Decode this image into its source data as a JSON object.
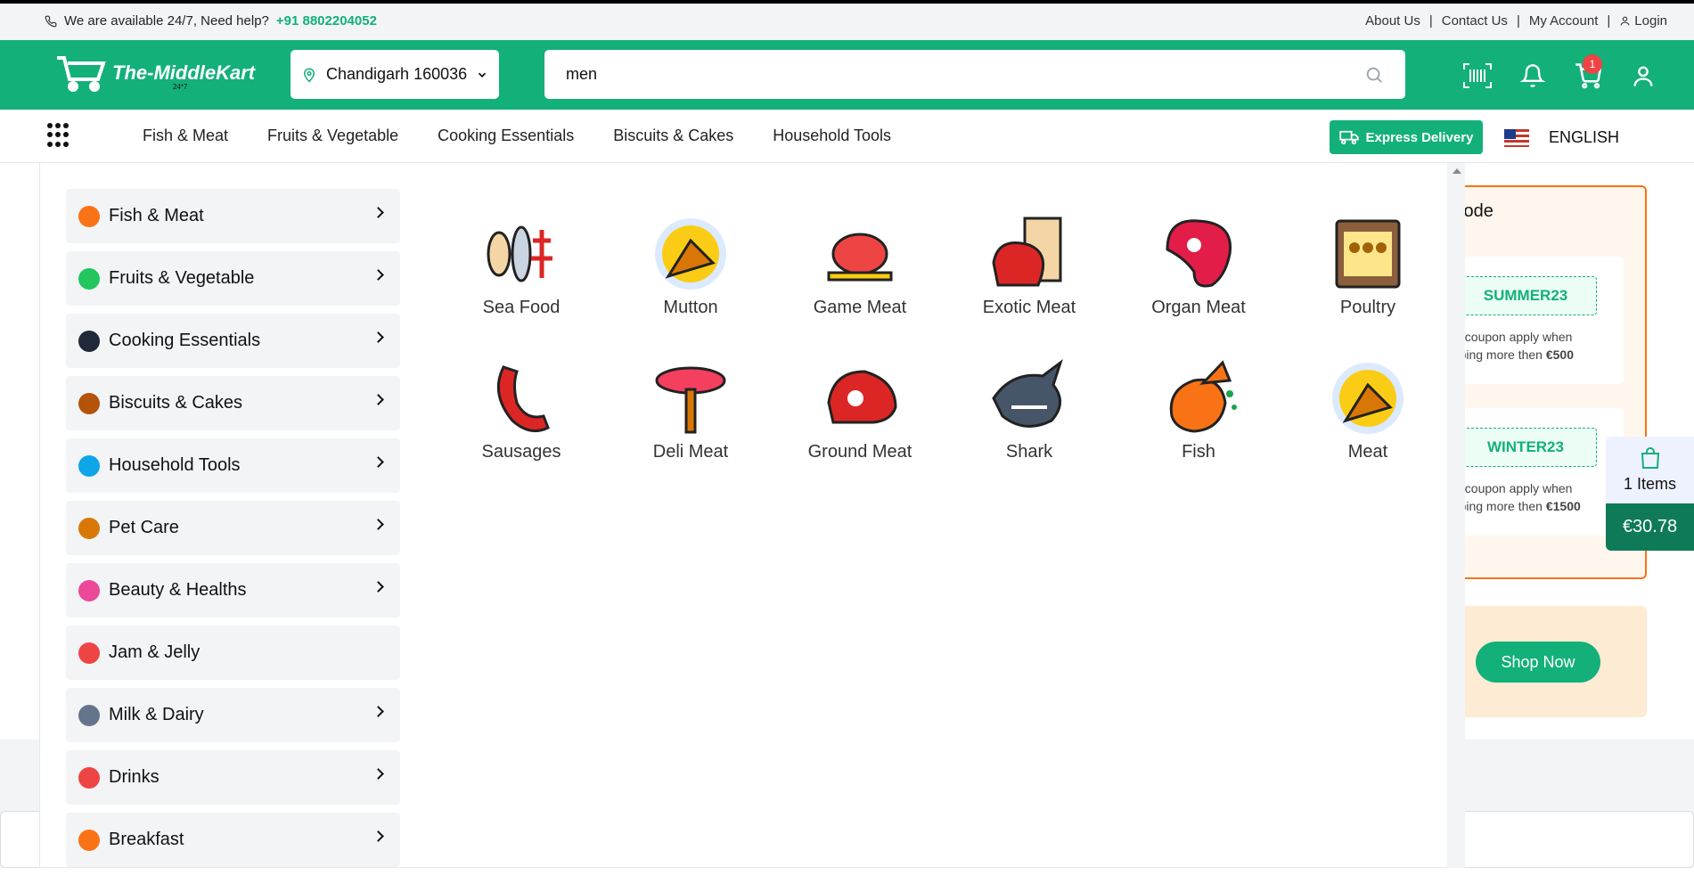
{
  "topbar": {
    "help_text": "We are available 24/7, Need help?",
    "phone": "+91 8802204052",
    "links": [
      "About Us",
      "Contact Us",
      "My Account",
      "Login"
    ]
  },
  "header": {
    "logo_text": "The-MiddleKart",
    "logo_sub": "24*7",
    "location": "Chandigarh 160036",
    "search_value": "men",
    "cart_count": "1"
  },
  "nav": {
    "links": [
      "Fish & Meat",
      "Fruits & Vegetable",
      "Cooking Essentials",
      "Biscuits & Cakes",
      "Household Tools"
    ],
    "express_label": "Express Delivery",
    "language": "ENGLISH"
  },
  "sidebar": {
    "categories": [
      {
        "label": "Fish & Meat",
        "color": "#f97316",
        "chevron": true
      },
      {
        "label": "Fruits & Vegetable",
        "color": "#22c55e",
        "chevron": true
      },
      {
        "label": "Cooking Essentials",
        "color": "#1f2937",
        "chevron": true
      },
      {
        "label": "Biscuits & Cakes",
        "color": "#b45309",
        "chevron": true
      },
      {
        "label": "Household Tools",
        "color": "#0ea5e9",
        "chevron": true
      },
      {
        "label": "Pet Care",
        "color": "#d97706",
        "chevron": true
      },
      {
        "label": "Beauty & Healths",
        "color": "#ec4899",
        "chevron": true
      },
      {
        "label": "Jam & Jelly",
        "color": "#ef4444",
        "chevron": false
      },
      {
        "label": "Milk & Dairy",
        "color": "#64748b",
        "chevron": true
      },
      {
        "label": "Drinks",
        "color": "#ef4444",
        "chevron": true
      },
      {
        "label": "Breakfast",
        "color": "#f97316",
        "chevron": true
      }
    ]
  },
  "subcategories": [
    {
      "label": "Sea Food",
      "icon": "seafood-icon",
      "color": "#f4a261"
    },
    {
      "label": "Mutton",
      "icon": "mutton-icon",
      "color": "#d97706"
    },
    {
      "label": "Game Meat",
      "icon": "game-meat-icon",
      "color": "#ef4444"
    },
    {
      "label": "Exotic Meat",
      "icon": "exotic-meat-icon",
      "color": "#dc2626"
    },
    {
      "label": "Organ Meat",
      "icon": "organ-meat-icon",
      "color": "#e11d48"
    },
    {
      "label": "Poultry",
      "icon": "poultry-icon",
      "color": "#8b5e3c"
    },
    {
      "label": "Sausages",
      "icon": "sausage-icon",
      "color": "#dc2626"
    },
    {
      "label": "Deli Meat",
      "icon": "deli-meat-icon",
      "color": "#f43f5e"
    },
    {
      "label": "Ground Meat",
      "icon": "ground-meat-icon",
      "color": "#dc2626"
    },
    {
      "label": "Shark",
      "icon": "shark-icon",
      "color": "#475569"
    },
    {
      "label": "Fish",
      "icon": "fish-icon",
      "color": "#f97316"
    },
    {
      "label": "Meat",
      "icon": "meat-icon",
      "color": "#d97706"
    }
  ],
  "coupon": {
    "title": "Code",
    "items": [
      {
        "code": "SUMMER23",
        "desc": "his coupon apply when",
        "desc2": "opping more then",
        "amount": "€500"
      },
      {
        "code": "WINTER23",
        "desc": "his coupon apply when",
        "desc2": "opping more then",
        "amount": "€1500"
      }
    ]
  },
  "promo": {
    "button": "Shop Now"
  },
  "cart_widget": {
    "items": "1 Items",
    "total": "€30.78"
  }
}
